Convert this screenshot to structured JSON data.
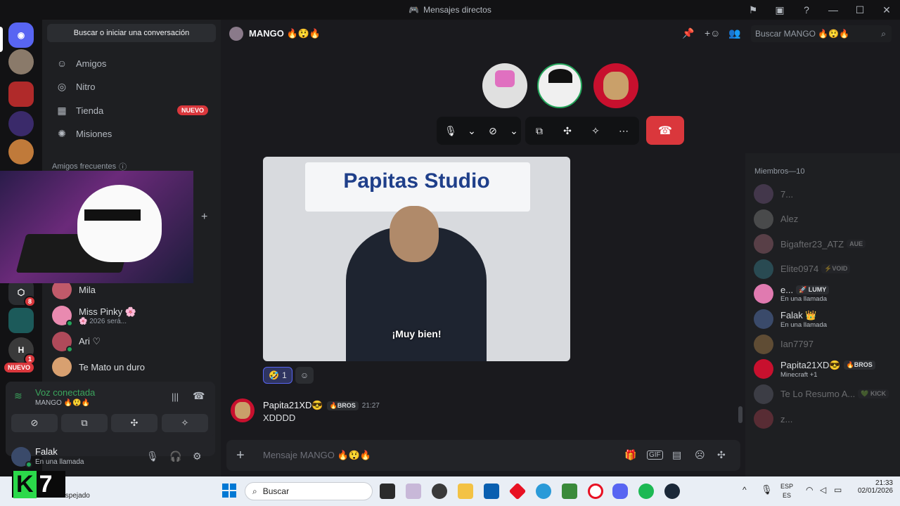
{
  "window": {
    "title": "Mensajes directos"
  },
  "sidebar": {
    "search_label": "Buscar o iniciar una conversación",
    "nav": [
      {
        "label": "Amigos",
        "icon": "friends-icon"
      },
      {
        "label": "Nitro",
        "icon": "nitro-icon"
      },
      {
        "label": "Tienda",
        "icon": "shop-icon",
        "badge": "NUEVO"
      },
      {
        "label": "Misiones",
        "icon": "quests-icon"
      }
    ],
    "frequent_label": "Amigos frecuentes",
    "dms": [
      {
        "name": "Mila",
        "sub": ""
      },
      {
        "name": "Miss Pinky 🌸",
        "sub": "🌸 2026 será..."
      },
      {
        "name": "Ari ♡",
        "sub": ""
      },
      {
        "name": "Te Mato un duro",
        "sub": ""
      }
    ],
    "rail_badges": {
      "server_b": "8",
      "server_h": "1",
      "new": "NUEVO"
    }
  },
  "voice": {
    "status": "Voz conectada",
    "channel": "MANGO 🔥😲🔥"
  },
  "user": {
    "name": "Falak",
    "status": "En una llamada"
  },
  "channel": {
    "name": "MANGO 🔥😲🔥",
    "search_placeholder": "Buscar MANGO 🔥😲🔥"
  },
  "chat": {
    "gif_caption": "Papitas Studio",
    "gif_subtitle": "¡Muy bien!",
    "reaction_count": "1",
    "message": {
      "author": "Papita21XD😎",
      "tag": "🔥BROS",
      "time": "21:27",
      "text": "XDDDD"
    },
    "composer_placeholder": "Mensaje MANGO 🔥😲🔥"
  },
  "members": {
    "header": "Miembros—10",
    "list": [
      {
        "name": "7...",
        "sub": "",
        "tag": "",
        "dim": true,
        "color": "#7a5c8a"
      },
      {
        "name": "Alez",
        "sub": "",
        "tag": "",
        "dim": true,
        "color": "#8a8a8a"
      },
      {
        "name": "Bigafter23_ATZ",
        "sub": "",
        "tag": "AUE",
        "dim": true,
        "color": "#b07080"
      },
      {
        "name": "Elite0974",
        "sub": "",
        "tag": "⚡VOID",
        "dim": true,
        "color": "#3a8a9a"
      },
      {
        "name": "e...",
        "sub": "En una llamada",
        "tag": "🚀 LUMY",
        "dim": false,
        "color": "#e07ab0"
      },
      {
        "name": "Falak 👑",
        "sub": "En una llamada",
        "tag": "",
        "dim": false,
        "color": "#3a4a6a"
      },
      {
        "name": "Ian7797",
        "sub": "",
        "tag": "",
        "dim": true,
        "color": "#c09050"
      },
      {
        "name": "Papita21XD😎",
        "sub": "Minecraft +1",
        "tag": "🔥BROS",
        "dim": false,
        "color": "#c8102e"
      },
      {
        "name": "Te Lo Resumo A...",
        "sub": "",
        "tag": "💚 KICK",
        "dim": true,
        "color": "#6a6a7a"
      },
      {
        "name": "z...",
        "sub": "",
        "tag": "",
        "dim": true,
        "color": "#b04050"
      }
    ]
  },
  "taskbar": {
    "search_label": "Buscar",
    "weather": "Despejado",
    "lang": "ESP",
    "lang2": "ES",
    "time": "21:33",
    "date": "02/01/2026",
    "overlay_logo": "7"
  }
}
